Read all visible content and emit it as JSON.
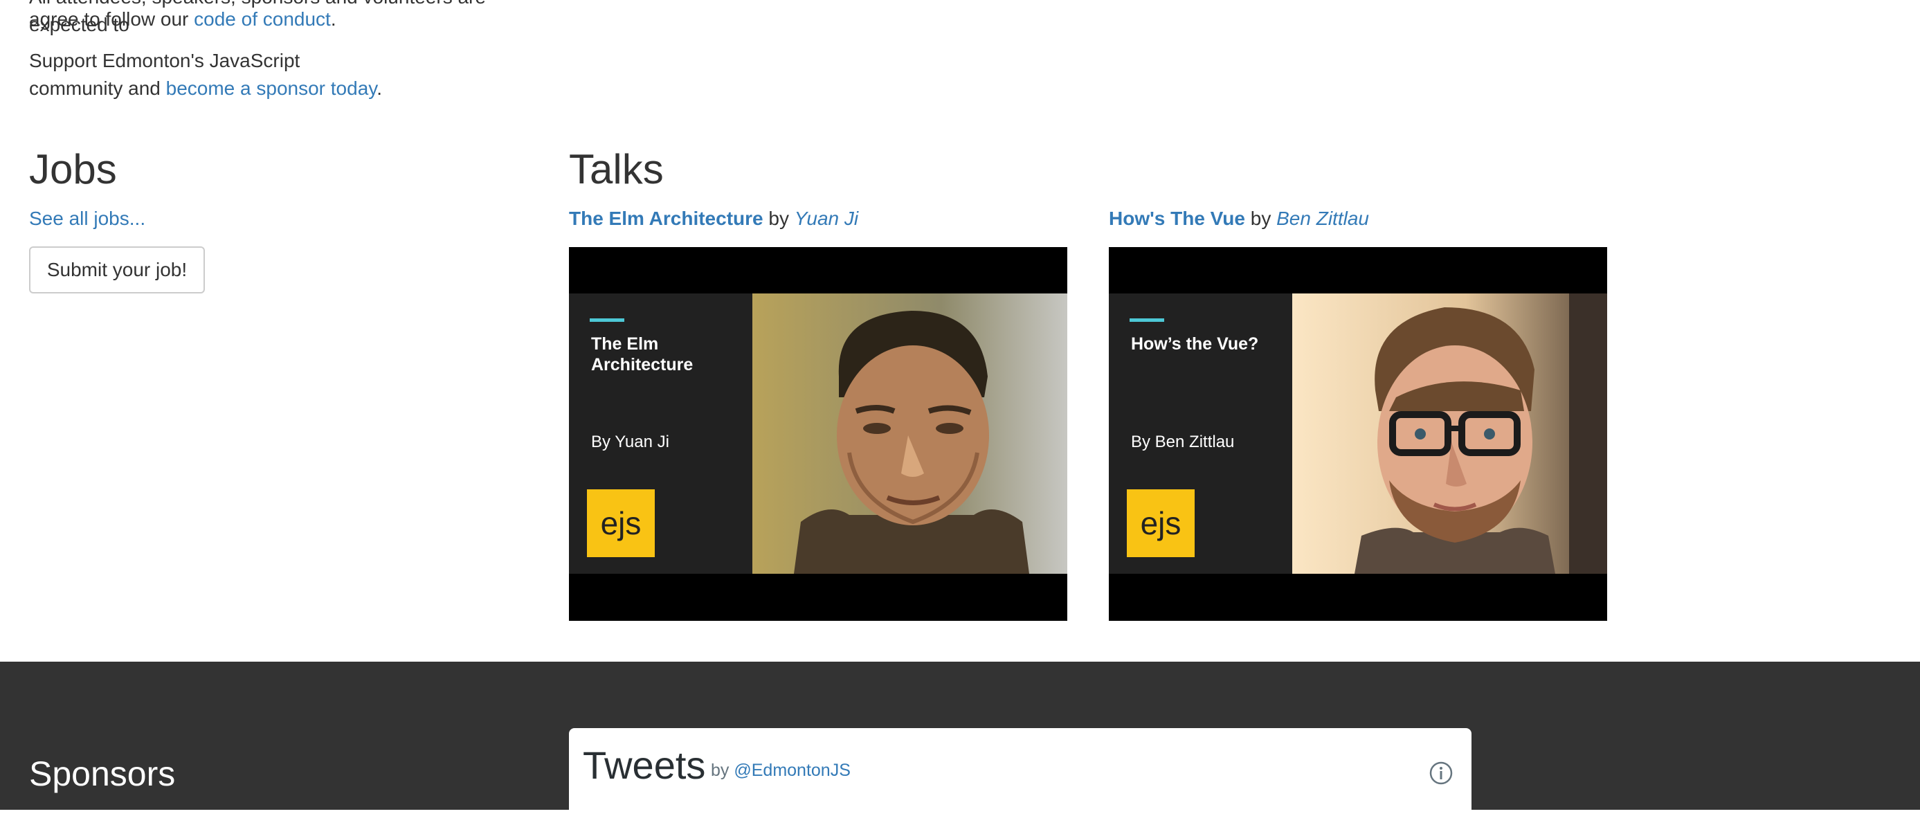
{
  "intro": {
    "cut_text": "All attendees, speakers, sponsors and volunteers are expected to",
    "conduct_prefix": "agree to follow our ",
    "conduct_link": "code of conduct",
    "conduct_suffix": ".",
    "sponsor_prefix": "Support Edmonton's JavaScript community and ",
    "sponsor_link": "become a sponsor today",
    "sponsor_suffix": "."
  },
  "jobs": {
    "heading": "Jobs",
    "see_all": "See all jobs...",
    "submit_label": "Submit your job!"
  },
  "talks": {
    "heading": "Talks",
    "items": [
      {
        "title": "The Elm Architecture",
        "by": " by ",
        "speaker": "Yuan Ji",
        "slide_title": "The Elm Architecture",
        "slide_author": "By Yuan Ji",
        "logo": "ejs"
      },
      {
        "title": "How's The Vue",
        "by": " by ",
        "speaker": "Ben Zittlau",
        "slide_title": "How’s the Vue?",
        "slide_author": "By Ben Zittlau",
        "logo": "ejs"
      }
    ]
  },
  "footer": {
    "sponsors_heading": "Sponsors",
    "tweets_title": "Tweets",
    "tweets_by": "by ",
    "tweets_handle": "@EdmontonJS",
    "info_icon": "info-icon"
  },
  "colors": {
    "link": "#337ab7",
    "footer_bg": "#333333",
    "logo_yellow": "#f9c314",
    "accent_cyan": "#4dc8d6"
  }
}
